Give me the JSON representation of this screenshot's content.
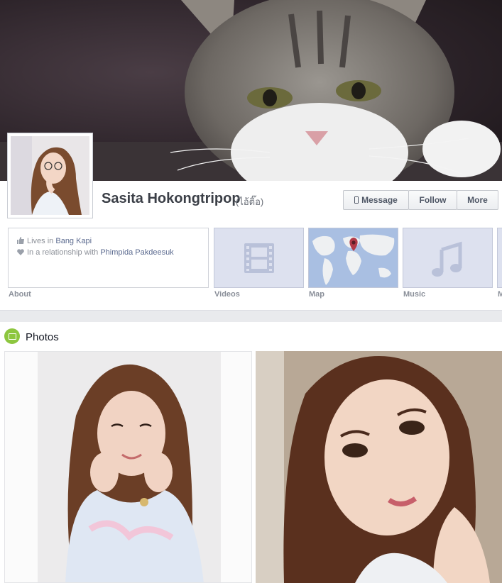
{
  "profile": {
    "name": "Sasita Hokongtripop",
    "alternate_name": "(ไอ้ติ๊อ)"
  },
  "actions": {
    "message_label": "Message",
    "follow_label": "Follow",
    "more_label": "More"
  },
  "about": {
    "lives_in_prefix": "Lives in",
    "lives_in_place": "Bang Kapi",
    "relationship_prefix": "In a relationship with",
    "relationship_partner": "Phimpida Pakdeesuk"
  },
  "tiles": {
    "about_label": "About",
    "videos_label": "Videos",
    "map_label": "Map",
    "music_label": "Music",
    "partial_label": "M"
  },
  "photos": {
    "section_title": "Photos"
  },
  "colors": {
    "tile_background": "#dde1ef",
    "link": "#5b6a8f",
    "photos_badge": "#8dc63f",
    "map_pin": "#b23a48"
  }
}
